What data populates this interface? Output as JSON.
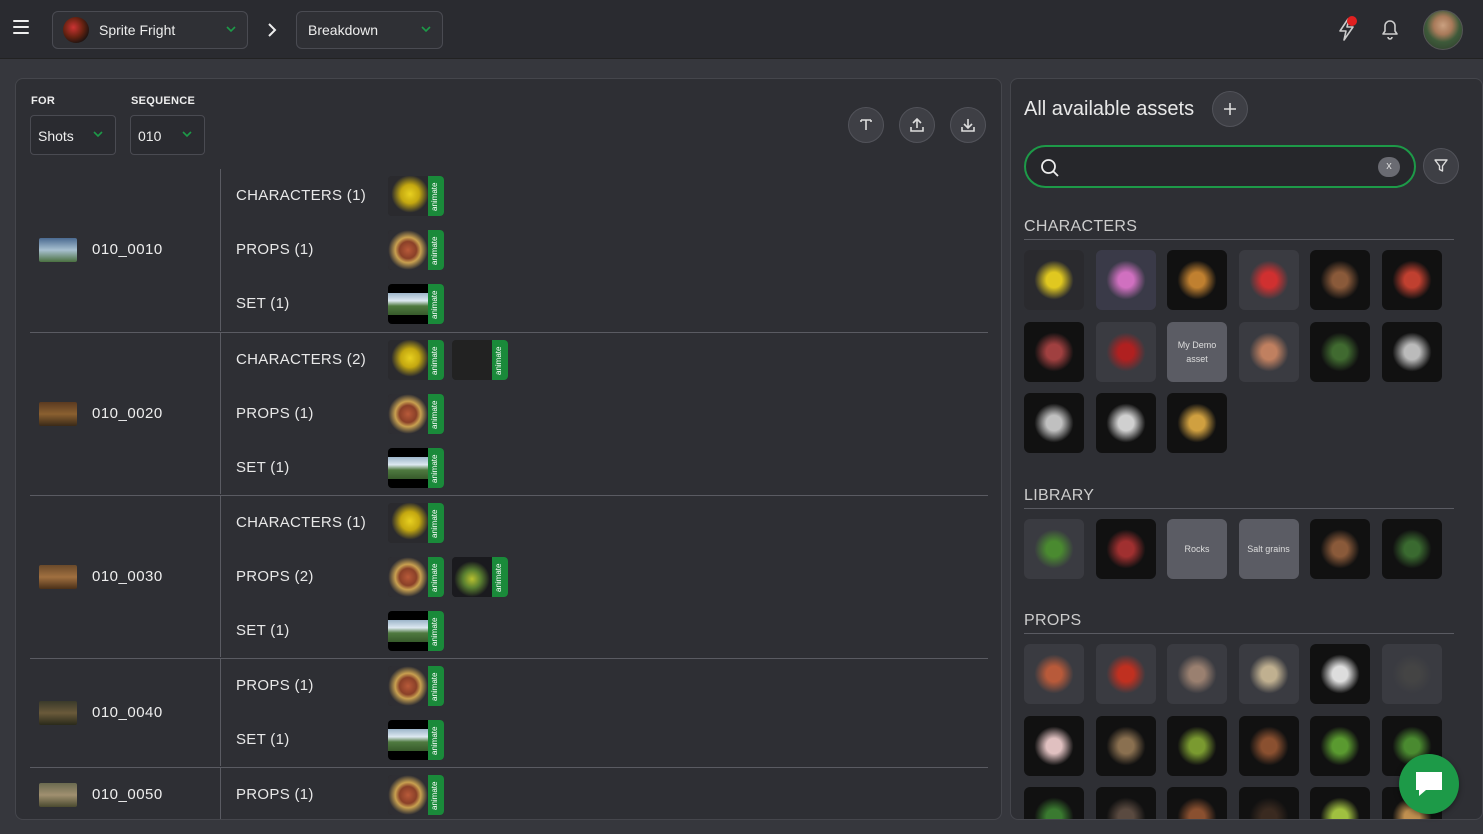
{
  "topbar": {
    "menu_icon": "hamburger-icon",
    "production": "Sprite Fright",
    "section": "Breakdown",
    "icons": [
      "news-icon",
      "notification-bell-icon",
      "user-avatar"
    ]
  },
  "filters": {
    "for_label": "FOR",
    "for_value": "Shots",
    "sequence_label": "SEQUENCE",
    "sequence_value": "010",
    "action_icons": [
      "text-mode-icon",
      "upload-icon",
      "download-icon"
    ]
  },
  "shots": [
    {
      "name": "010_0010",
      "rows": [
        {
          "label": "CHARACTERS (1)",
          "assets": [
            "bird"
          ]
        },
        {
          "label": "PROPS (1)",
          "assets": [
            "props"
          ]
        },
        {
          "label": "SET (1)",
          "assets": [
            "set"
          ]
        }
      ]
    },
    {
      "name": "010_0020",
      "rows": [
        {
          "label": "CHARACTERS (2)",
          "assets": [
            "bird",
            "ladybug"
          ]
        },
        {
          "label": "PROPS (1)",
          "assets": [
            "props"
          ]
        },
        {
          "label": "SET (1)",
          "assets": [
            "set"
          ]
        }
      ]
    },
    {
      "name": "010_0030",
      "rows": [
        {
          "label": "CHARACTERS (1)",
          "assets": [
            "bird"
          ]
        },
        {
          "label": "PROPS (2)",
          "assets": [
            "props",
            "tree"
          ]
        },
        {
          "label": "SET (1)",
          "assets": [
            "set"
          ]
        }
      ]
    },
    {
      "name": "010_0040",
      "rows": [
        {
          "label": "PROPS (1)",
          "assets": [
            "props"
          ]
        },
        {
          "label": "SET (1)",
          "assets": [
            "set"
          ]
        }
      ]
    },
    {
      "name": "010_0050",
      "rows": [
        {
          "label": "PROPS (1)",
          "assets": [
            "props"
          ]
        }
      ]
    }
  ],
  "tag_label": "animate",
  "assets_panel": {
    "title": "All available assets",
    "add_icon": "plus-icon",
    "search_value": "",
    "clear_label": "x",
    "filter_icon": "filter-icon",
    "sections": [
      {
        "title": "CHARACTERS",
        "tiles": [
          {
            "kind": "img",
            "c1": "#e0c820",
            "c2": "#2a2a2e"
          },
          {
            "kind": "img",
            "c1": "#d070c0",
            "c2": "#3a3a48"
          },
          {
            "kind": "img",
            "c1": "#c08030",
            "c2": "#111"
          },
          {
            "kind": "img",
            "c1": "#d03030",
            "c2": "#3a3b41"
          },
          {
            "kind": "img",
            "c1": "#8a5a3a",
            "c2": "#111"
          },
          {
            "kind": "img",
            "c1": "#c04030",
            "c2": "#111"
          },
          {
            "kind": "img",
            "c1": "#a04040",
            "c2": "#111"
          },
          {
            "kind": "img",
            "c1": "#b02020",
            "c2": "#3a3b41"
          },
          {
            "kind": "text",
            "text": "My Demo asset"
          },
          {
            "kind": "img",
            "c1": "#c08060",
            "c2": "#3a3b41"
          },
          {
            "kind": "img",
            "c1": "#406a30",
            "c2": "#111"
          },
          {
            "kind": "img",
            "c1": "#bbbbbb",
            "c2": "#111"
          },
          {
            "kind": "img",
            "c1": "#c0c0c0",
            "c2": "#111"
          },
          {
            "kind": "img",
            "c1": "#d0d0d0",
            "c2": "#111"
          },
          {
            "kind": "img",
            "c1": "#d0a040",
            "c2": "#111"
          }
        ]
      },
      {
        "title": "LIBRARY",
        "tiles": [
          {
            "kind": "img",
            "c1": "#4a8a30",
            "c2": "#3a3b41"
          },
          {
            "kind": "img",
            "c1": "#a03030",
            "c2": "#111"
          },
          {
            "kind": "text",
            "text": "Rocks"
          },
          {
            "kind": "text",
            "text": "Salt grains"
          },
          {
            "kind": "img",
            "c1": "#8a5a3a",
            "c2": "#111"
          },
          {
            "kind": "img",
            "c1": "#3a6a30",
            "c2": "#111"
          }
        ]
      },
      {
        "title": "PROPS",
        "tiles": [
          {
            "kind": "img",
            "c1": "#b85a3a",
            "c2": "#3a3b41"
          },
          {
            "kind": "img",
            "c1": "#c03020",
            "c2": "#3a3b41"
          },
          {
            "kind": "img",
            "c1": "#9a8070",
            "c2": "#3a3b41"
          },
          {
            "kind": "img",
            "c1": "#c0b090",
            "c2": "#3a3b41"
          },
          {
            "kind": "img",
            "c1": "#dddddd",
            "c2": "#111"
          },
          {
            "kind": "img",
            "c1": "#444444",
            "c2": "#3a3b41"
          },
          {
            "kind": "img",
            "c1": "#e0c0c0",
            "c2": "#111"
          },
          {
            "kind": "img",
            "c1": "#8a7050",
            "c2": "#111"
          },
          {
            "kind": "img",
            "c1": "#7a9a30",
            "c2": "#111"
          },
          {
            "kind": "img",
            "c1": "#8a5030",
            "c2": "#111"
          },
          {
            "kind": "img",
            "c1": "#5a9a30",
            "c2": "#111"
          },
          {
            "kind": "img",
            "c1": "#4a8a30",
            "c2": "#111"
          },
          {
            "kind": "img",
            "c1": "#3a7a30",
            "c2": "#111"
          },
          {
            "kind": "img",
            "c1": "#5a4a40",
            "c2": "#111"
          },
          {
            "kind": "img",
            "c1": "#8a5030",
            "c2": "#111"
          },
          {
            "kind": "img",
            "c1": "#3a2a20",
            "c2": "#111"
          },
          {
            "kind": "img",
            "c1": "#a0c040",
            "c2": "#111"
          },
          {
            "kind": "img",
            "c1": "#c09050",
            "c2": "#111"
          }
        ]
      }
    ]
  },
  "chat_icon": "chat-bubble-icon"
}
